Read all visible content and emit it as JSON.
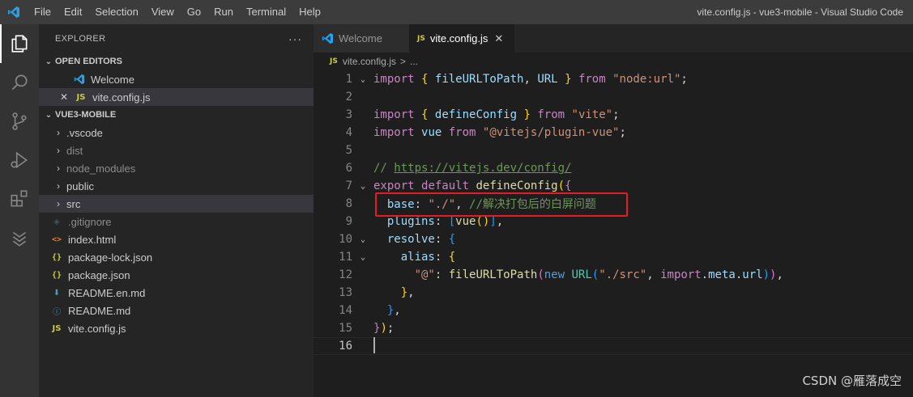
{
  "titlebar": {
    "menu": [
      "File",
      "Edit",
      "Selection",
      "View",
      "Go",
      "Run",
      "Terminal",
      "Help"
    ],
    "window_title": "vite.config.js - vue3-mobile - Visual Studio Code"
  },
  "activitybar": {
    "icons": [
      "explorer-icon",
      "search-icon",
      "source-control-icon",
      "run-debug-icon",
      "extensions-icon",
      "remote-explorer-icon"
    ]
  },
  "sidebar": {
    "title": "EXPLORER",
    "more": "···",
    "open_editors": {
      "label": "OPEN EDITORS",
      "items": [
        {
          "name": "Welcome",
          "icon": "vscode-icon"
        },
        {
          "name": "vite.config.js",
          "icon": "JS",
          "close": "✕"
        }
      ]
    },
    "project": {
      "label": "VUE3-MOBILE",
      "items": [
        {
          "name": ".vscode",
          "type": "folder"
        },
        {
          "name": "dist",
          "type": "folder"
        },
        {
          "name": "node_modules",
          "type": "folder"
        },
        {
          "name": "public",
          "type": "folder"
        },
        {
          "name": "src",
          "type": "folder"
        },
        {
          "name": ".gitignore",
          "icon": "◈"
        },
        {
          "name": "index.html",
          "icon": "<>"
        },
        {
          "name": "package-lock.json",
          "icon": "{}"
        },
        {
          "name": "package.json",
          "icon": "{}"
        },
        {
          "name": "README.en.md",
          "icon": "⬇"
        },
        {
          "name": "README.md",
          "icon": "ⓘ"
        },
        {
          "name": "vite.config.js",
          "icon": "JS"
        }
      ]
    }
  },
  "tabs": [
    {
      "label": "Welcome",
      "active": false
    },
    {
      "label": "vite.config.js",
      "active": true,
      "close": "✕"
    }
  ],
  "breadcrumb": {
    "file": "vite.config.js",
    "sep": ">",
    "rest": "..."
  },
  "code": {
    "line_numbers": [
      "1",
      "2",
      "3",
      "4",
      "5",
      "6",
      "7",
      "8",
      "9",
      "10",
      "11",
      "12",
      "13",
      "14",
      "15",
      "16"
    ],
    "lines": [
      "import { fileURLToPath, URL } from \"node:url\";",
      "",
      "import { defineConfig } from \"vite\";",
      "import vue from \"@vitejs/plugin-vue\";",
      "",
      "// https://vitejs.dev/config/",
      "export default defineConfig({",
      "  base: \"./\", //解决打包后的白屏问题",
      "  plugins: [vue()],",
      "  resolve: {",
      "    alias: {",
      "      \"@\": fileURLToPath(new URL(\"./src\", import.meta.url)),",
      "    },",
      "  },",
      "});",
      ""
    ]
  },
  "watermark": "CSDN @雁落成空"
}
